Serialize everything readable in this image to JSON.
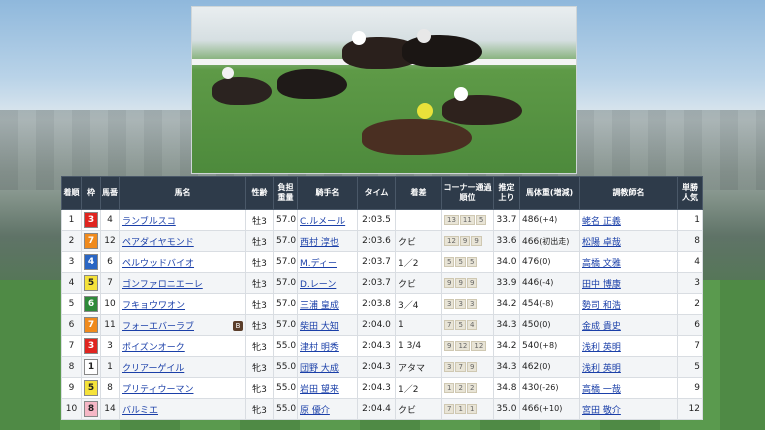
{
  "header": {
    "chakujun": "着順",
    "waku": "枠",
    "umaban": "馬番",
    "bamei": "馬名",
    "seirei": "性齢",
    "futan": "負担重量",
    "kishu": "騎手名",
    "time": "タイム",
    "chakusa": "着差",
    "corner": "コーナー通過順位",
    "agari": "推定上り",
    "bataiju": "馬体重(増減)",
    "chokyoshi": "調教師名",
    "ninki": "単勝人気"
  },
  "colors": {
    "waku_1": "#ffffff",
    "waku_3": "#e0241f",
    "waku_4": "#2a66c4",
    "waku_5": "#f5e23a",
    "waku_6": "#2f8a3a",
    "waku_7": "#f08a1c",
    "waku_8": "#f6b7c6",
    "header_bg": "#2e3b4a",
    "link": "#1a3fa8"
  },
  "rows": [
    {
      "pos": "1",
      "waku": "3",
      "num": "4",
      "name": "ランブルスコ",
      "sex": "牡3",
      "wt": "57.0",
      "jockey": "C.ルメール",
      "time": "2:03.5",
      "margin": "",
      "corner": [
        "13",
        "11",
        "5"
      ],
      "agari": "33.7",
      "body": "486",
      "diff": "(+4)",
      "trainer": "蛯名 正義",
      "pop": "1"
    },
    {
      "pos": "2",
      "waku": "7",
      "num": "12",
      "name": "ペアダイヤモンド",
      "sex": "牡3",
      "wt": "57.0",
      "jockey": "西村 淳也",
      "time": "2:03.6",
      "margin": "クビ",
      "corner": [
        "12",
        "9",
        "9"
      ],
      "agari": "33.6",
      "body": "466",
      "diff": "(初出走)",
      "trainer": "松陽 卓哉",
      "pop": "8"
    },
    {
      "pos": "3",
      "waku": "4",
      "num": "6",
      "name": "ペルウッドバイオ",
      "sex": "牡3",
      "wt": "57.0",
      "jockey": "M.ディー",
      "time": "2:03.7",
      "margin": "1／2",
      "corner": [
        "5",
        "5",
        "5"
      ],
      "agari": "34.0",
      "body": "476",
      "diff": "(0)",
      "trainer": "高橋 文雅",
      "pop": "4"
    },
    {
      "pos": "4",
      "waku": "5",
      "num": "7",
      "name": "ゴンファロニエーレ",
      "sex": "牡3",
      "wt": "57.0",
      "jockey": "D.レーン",
      "time": "2:03.7",
      "margin": "クビ",
      "corner": [
        "9",
        "9",
        "9"
      ],
      "agari": "33.9",
      "body": "446",
      "diff": "(-4)",
      "trainer": "田中 博康",
      "pop": "3"
    },
    {
      "pos": "5",
      "waku": "6",
      "num": "10",
      "name": "フキョウワオン",
      "sex": "牡3",
      "wt": "57.0",
      "jockey": "三浦 皇成",
      "time": "2:03.8",
      "margin": "3／4",
      "corner": [
        "3",
        "3",
        "3"
      ],
      "agari": "34.2",
      "body": "454",
      "diff": "(-8)",
      "trainer": "勢司 和浩",
      "pop": "2"
    },
    {
      "pos": "6",
      "waku": "7",
      "num": "11",
      "name": "フォーエバーラブ",
      "badge": "B",
      "sex": "牡3",
      "wt": "57.0",
      "jockey": "柴田 大知",
      "time": "2:04.0",
      "margin": "1",
      "corner": [
        "7",
        "5",
        "4"
      ],
      "agari": "34.3",
      "body": "450",
      "diff": "(0)",
      "trainer": "金成 貴史",
      "pop": "6"
    },
    {
      "pos": "7",
      "waku": "3",
      "num": "3",
      "name": "ポイズンオーク",
      "sex": "牝3",
      "wt": "55.0",
      "jockey": "津村 明秀",
      "time": "2:04.3",
      "margin": "1 3/4",
      "corner": [
        "9",
        "12",
        "12"
      ],
      "agari": "34.2",
      "body": "540",
      "diff": "(+8)",
      "trainer": "浅利 英明",
      "pop": "7"
    },
    {
      "pos": "8",
      "waku": "1",
      "num": "1",
      "name": "クリアーゲイル",
      "sex": "牝3",
      "wt": "55.0",
      "jockey": "団野 大成",
      "time": "2:04.3",
      "margin": "アタマ",
      "corner": [
        "3",
        "7",
        "9"
      ],
      "agari": "34.3",
      "body": "462",
      "diff": "(0)",
      "trainer": "浅利 英明",
      "pop": "5"
    },
    {
      "pos": "9",
      "waku": "5",
      "num": "8",
      "name": "プリティウーマン",
      "sex": "牝3",
      "wt": "55.0",
      "jockey": "岩田 望来",
      "time": "2:04.3",
      "margin": "1／2",
      "corner": [
        "1",
        "2",
        "2"
      ],
      "agari": "34.8",
      "body": "430",
      "diff": "(-26)",
      "trainer": "高橋 一哉",
      "pop": "9"
    },
    {
      "pos": "10",
      "waku": "8",
      "num": "14",
      "name": "バルミエ",
      "sex": "牝3",
      "wt": "55.0",
      "jockey": "原 優介",
      "time": "2:04.4",
      "margin": "クビ",
      "corner": [
        "7",
        "1",
        "1"
      ],
      "agari": "35.0",
      "body": "466",
      "diff": "(+10)",
      "trainer": "宮田 敬介",
      "pop": "12"
    }
  ]
}
